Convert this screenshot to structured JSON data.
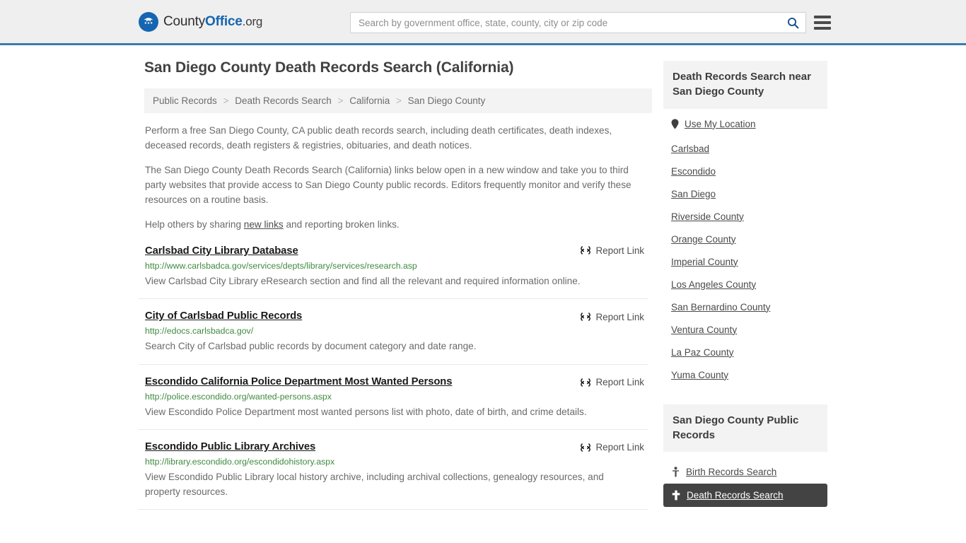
{
  "header": {
    "brand": {
      "part1": "County",
      "part2": "Office",
      "part3": ".org",
      "logo_icon": "eagle-shield-icon"
    },
    "search": {
      "placeholder": "Search by government office, state, county, city or zip code",
      "value": "",
      "button_icon": "search-icon"
    },
    "menu_icon": "hamburger-menu-icon",
    "accent_color": "#3b7ab0"
  },
  "main": {
    "title": "San Diego County Death Records Search (California)",
    "breadcrumb": [
      {
        "label": "Public Records"
      },
      {
        "label": "Death Records Search"
      },
      {
        "label": "California"
      },
      {
        "label": "San Diego County"
      }
    ],
    "breadcrumb_separator": ">",
    "paragraphs": [
      "Perform a free San Diego County, CA public death records search, including death certificates, death indexes, deceased records, death registers & registries, obituaries, and death notices.",
      "The San Diego County Death Records Search (California) links below open in a new window and take you to third party websites that provide access to San Diego County public records. Editors frequently monitor and verify these resources on a routine basis."
    ],
    "help_line": {
      "before": "Help others by sharing ",
      "link": "new links",
      "after": " and reporting broken links."
    },
    "report_link_label": "Report Link",
    "report_link_icon": "broken-link-icon",
    "results": [
      {
        "title": "Carlsbad City Library Database",
        "url": "http://www.carlsbadca.gov/services/depts/library/services/research.asp",
        "description": "View Carlsbad City Library eResearch section and find all the relevant and required information online."
      },
      {
        "title": "City of Carlsbad Public Records",
        "url": "http://edocs.carlsbadca.gov/",
        "description": "Search City of Carlsbad public records by document category and date range."
      },
      {
        "title": "Escondido California Police Department Most Wanted Persons",
        "url": "http://police.escondido.org/wanted-persons.aspx",
        "description": "View Escondido Police Department most wanted persons list with photo, date of birth, and crime details."
      },
      {
        "title": "Escondido Public Library Archives",
        "url": "http://library.escondido.org/escondidohistory.aspx",
        "description": "View Escondido Public Library local history archive, including archival collections, genealogy resources, and property resources."
      }
    ]
  },
  "rail": {
    "near_heading": "Death Records Search near San Diego County",
    "near_items": [
      {
        "label": "Use My Location",
        "icon": "map-pin-icon"
      },
      {
        "label": "Carlsbad",
        "icon": ""
      },
      {
        "label": "Escondido",
        "icon": ""
      },
      {
        "label": "San Diego",
        "icon": ""
      },
      {
        "label": "Riverside County",
        "icon": ""
      },
      {
        "label": "Orange County",
        "icon": ""
      },
      {
        "label": "Imperial County",
        "icon": ""
      },
      {
        "label": "Los Angeles County",
        "icon": ""
      },
      {
        "label": "San Bernardino County",
        "icon": ""
      },
      {
        "label": "Ventura County",
        "icon": ""
      },
      {
        "label": "La Paz County",
        "icon": ""
      },
      {
        "label": "Yuma County",
        "icon": ""
      }
    ],
    "public_records_heading": "San Diego County Public Records",
    "public_records_items": [
      {
        "label": "Birth Records Search",
        "icon": "baby-icon",
        "active": false
      },
      {
        "label": "Death Records Search",
        "icon": "cross-icon",
        "active": true
      }
    ],
    "active_bg": "#434343"
  }
}
